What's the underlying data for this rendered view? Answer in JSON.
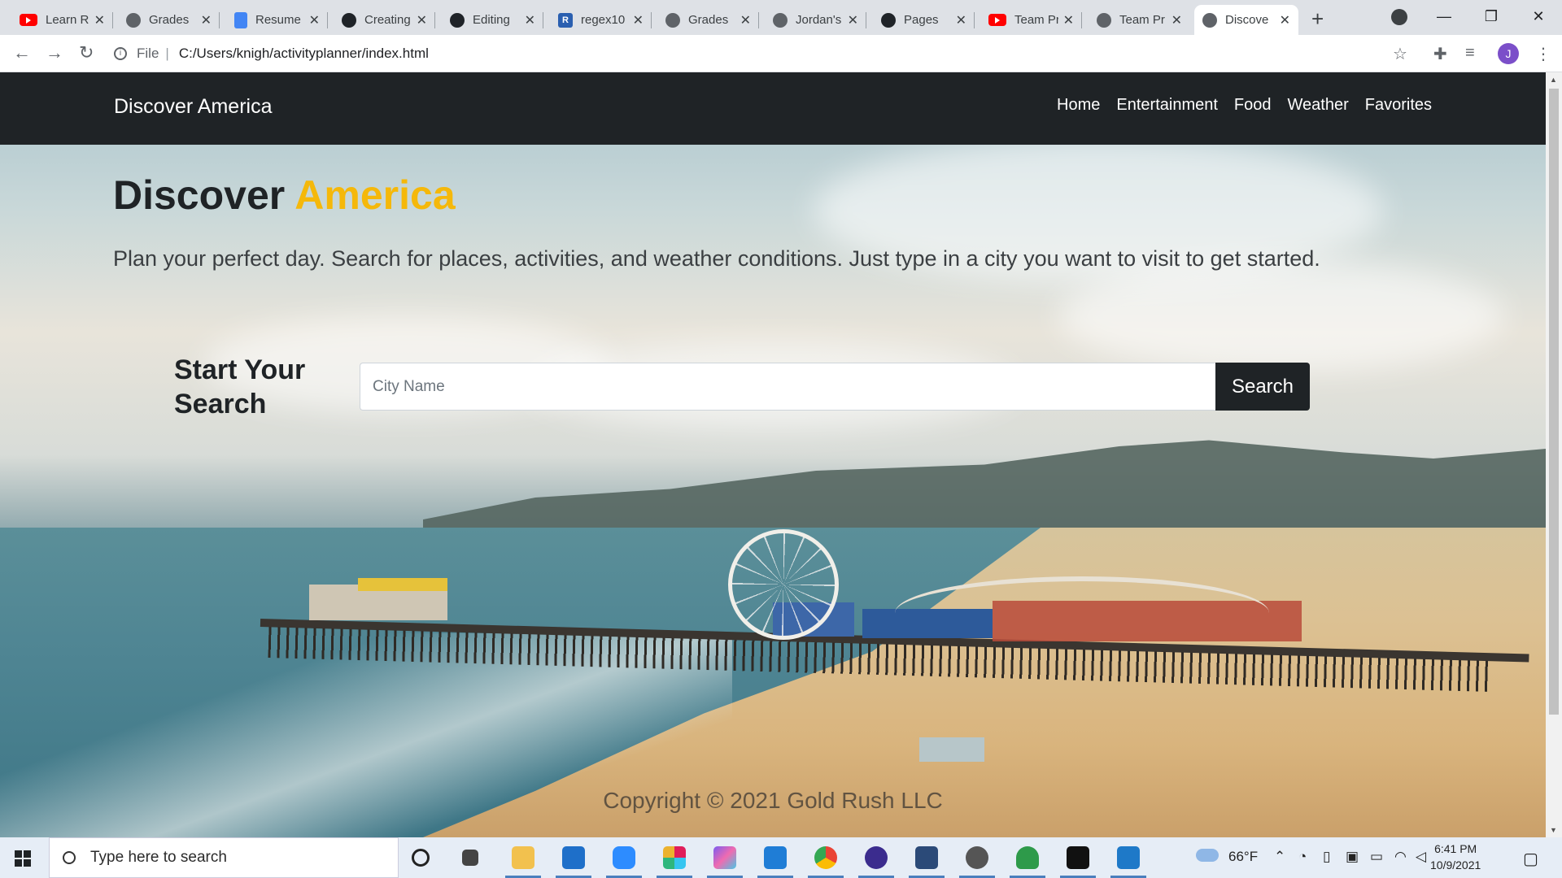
{
  "browser": {
    "tabs": [
      {
        "title": "Learn R",
        "icon": "youtube-icon"
      },
      {
        "title": "Grades",
        "icon": "globe-icon"
      },
      {
        "title": "Resume",
        "icon": "docs-icon"
      },
      {
        "title": "Creating",
        "icon": "github-icon"
      },
      {
        "title": "Editing",
        "icon": "github-icon"
      },
      {
        "title": "regex10",
        "icon": "r-icon"
      },
      {
        "title": "Grades",
        "icon": "globe-icon"
      },
      {
        "title": "Jordan's",
        "icon": "globe-icon"
      },
      {
        "title": "Pages",
        "icon": "github-icon"
      },
      {
        "title": "Team Pr",
        "icon": "youtube-icon"
      },
      {
        "title": "Team Pr",
        "icon": "globe-icon"
      },
      {
        "title": "Discove",
        "icon": "globe-icon",
        "active": true
      }
    ],
    "scheme_label": "File",
    "url": "C:/Users/knigh/activityplanner/index.html",
    "profile_initial": "J"
  },
  "navbar": {
    "brand": "Discover America",
    "links": [
      "Home",
      "Entertainment",
      "Food",
      "Weather",
      "Favorites"
    ]
  },
  "hero": {
    "title_main": "Discover",
    "title_accent": "America",
    "lead": "Plan your perfect day. Search for places, activities, and weather conditions. Just type in a city you want to visit to get started."
  },
  "search": {
    "label_line1": "Start Your",
    "label_line2": "Search",
    "placeholder": "City Name",
    "button": "Search"
  },
  "footer": {
    "copyright": "Copyright © 2021 Gold Rush LLC"
  },
  "taskbar": {
    "search_placeholder": "Type here to search",
    "weather": "66°F",
    "time": "6:41 PM",
    "date": "10/9/2021"
  },
  "colors": {
    "navbar_bg": "#1f2326",
    "accent": "#f5b80a"
  }
}
